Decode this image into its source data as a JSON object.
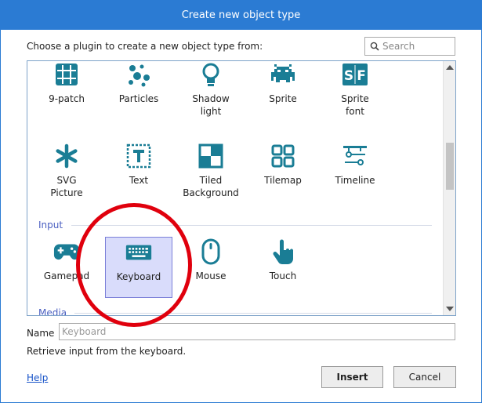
{
  "dialog": {
    "title": "Create new object type",
    "prompt": "Choose a plugin to create a new object type from:",
    "search": {
      "placeholder": "Search",
      "value": ""
    },
    "colors": {
      "accent": "#2b7bd3",
      "icon": "#1a7d95",
      "section": "#4a5fc1",
      "selection": "#d9dcfb",
      "annotation": "#e0000d"
    },
    "rows": {
      "general_top": [
        {
          "label": "9-patch",
          "icon": "nine-patch-icon"
        },
        {
          "label": "Particles",
          "icon": "particles-icon"
        },
        {
          "label": "Shadow light",
          "icon": "lightbulb-icon"
        },
        {
          "label": "Sprite",
          "icon": "space-invader-icon"
        },
        {
          "label": "Sprite font",
          "icon": "sprite-font-icon"
        }
      ],
      "general_bottom": [
        {
          "label": "SVG Picture",
          "icon": "asterisk-icon"
        },
        {
          "label": "Text",
          "icon": "text-box-icon"
        },
        {
          "label": "Tiled Background",
          "icon": "tiled-icon"
        },
        {
          "label": "Tilemap",
          "icon": "tilemap-icon"
        },
        {
          "label": "Timeline",
          "icon": "timeline-icon"
        }
      ]
    },
    "sections": {
      "input": {
        "label": "Input",
        "items": [
          {
            "label": "Gamepad",
            "icon": "gamepad-icon"
          },
          {
            "label": "Keyboard",
            "icon": "keyboard-icon"
          },
          {
            "label": "Mouse",
            "icon": "mouse-icon"
          },
          {
            "label": "Touch",
            "icon": "touch-icon"
          }
        ]
      },
      "media": {
        "label": "Media"
      }
    },
    "selected": "Keyboard",
    "name": {
      "label": "Name",
      "placeholder": "Keyboard",
      "value": ""
    },
    "description": "Retrieve input from the keyboard.",
    "help_link": "Help",
    "buttons": {
      "insert": "Insert",
      "cancel": "Cancel"
    }
  }
}
